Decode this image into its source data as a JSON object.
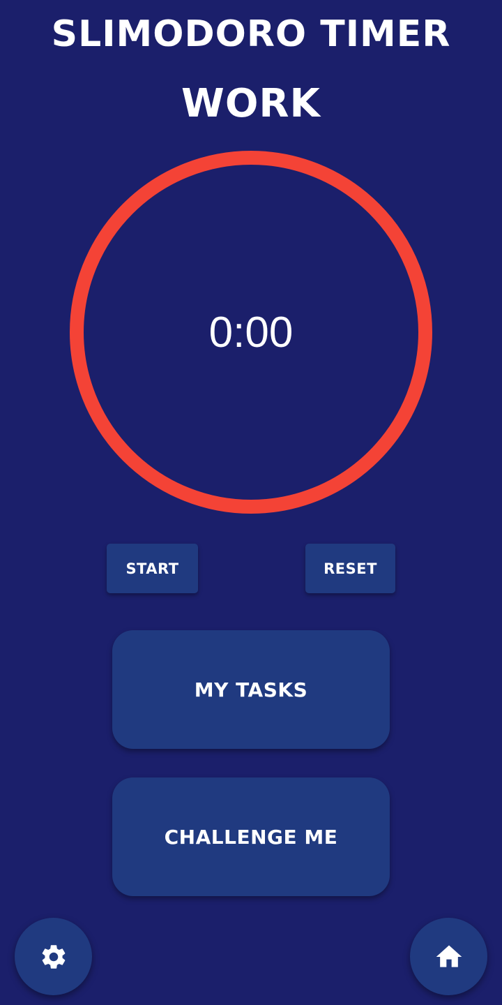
{
  "header": {
    "app_title": "SLIMODORO TIMER",
    "mode": "WORK"
  },
  "timer": {
    "display": "0:00",
    "progress": 1.0,
    "ring_color": "#f44336"
  },
  "controls": {
    "start_label": "START",
    "reset_label": "RESET"
  },
  "actions": {
    "tasks_label": "MY TASKS",
    "challenge_label": "CHALLENGE ME"
  },
  "nav": {
    "settings_icon": "gear-icon",
    "home_icon": "home-icon"
  },
  "colors": {
    "background": "#1b1f6b",
    "button": "#203a80",
    "accent": "#f44336"
  }
}
